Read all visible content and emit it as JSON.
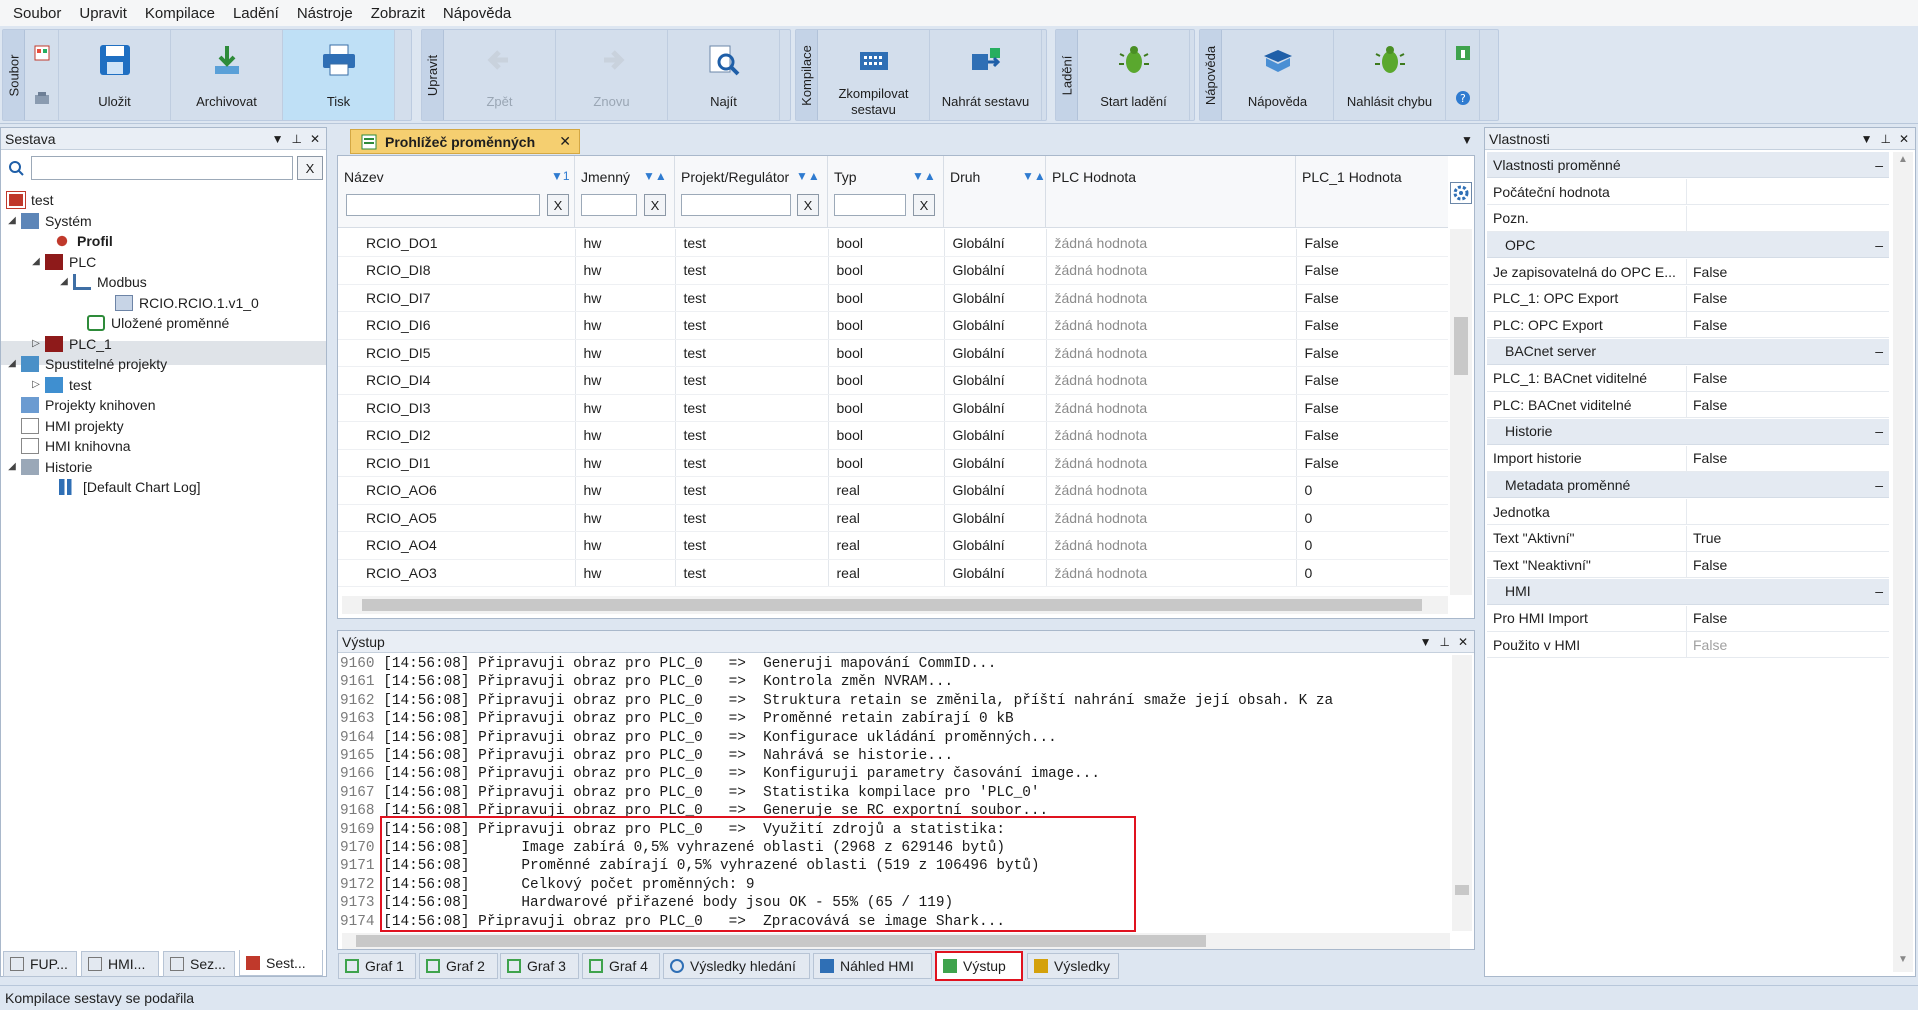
{
  "menu": [
    "Soubor",
    "Upravit",
    "Kompilace",
    "Ladění",
    "Nástroje",
    "Zobrazit",
    "Nápověda"
  ],
  "ribbon": {
    "groups": [
      "Soubor",
      "Upravit",
      "Kompilace",
      "Ladění",
      "Nápověda"
    ],
    "buttons": {
      "save": "Uložit",
      "archive": "Archivovat",
      "print": "Tisk",
      "undo": "Zpět",
      "redo": "Znovu",
      "find": "Najít",
      "compile": "Zkompilovat sestavu",
      "upload": "Nahrát sestavu",
      "debug": "Start ladění",
      "help": "Nápověda",
      "report": "Nahlásit chybu"
    }
  },
  "left_panel": {
    "title": "Sestava",
    "search_clear": "X",
    "tree": [
      "test",
      "Systém",
      "Profil",
      "PLC",
      "Modbus",
      "RCIO.RCIO.1.v1_0",
      "Uložené proměnné",
      "PLC_1",
      "Spustitelné projekty",
      "test",
      "Projekty knihoven",
      "HMI projekty",
      "HMI knihovna",
      "Historie",
      "[Default Chart Log]"
    ],
    "bottom_tabs": [
      "FUP...",
      "HMI...",
      "Sez...",
      "Sest..."
    ]
  },
  "doc_tab": {
    "title": "Prohlížeč proměnných",
    "close": "✕"
  },
  "grid": {
    "columns": [
      "Název",
      "Jmenný",
      "Projekt/Regulátor",
      "Typ",
      "Druh",
      "PLC Hodnota",
      "PLC_1 Hodnota"
    ],
    "sort_labels": [
      "▼1",
      "▼▲",
      "▼▲",
      "▼▲",
      "▼▲"
    ],
    "filter_clear": "X",
    "rows": [
      [
        "RCIO_DO1",
        "hw",
        "test",
        "bool",
        "Globální",
        "žádná hodnota",
        "False"
      ],
      [
        "RCIO_DI8",
        "hw",
        "test",
        "bool",
        "Globální",
        "žádná hodnota",
        "False"
      ],
      [
        "RCIO_DI7",
        "hw",
        "test",
        "bool",
        "Globální",
        "žádná hodnota",
        "False"
      ],
      [
        "RCIO_DI6",
        "hw",
        "test",
        "bool",
        "Globální",
        "žádná hodnota",
        "False"
      ],
      [
        "RCIO_DI5",
        "hw",
        "test",
        "bool",
        "Globální",
        "žádná hodnota",
        "False"
      ],
      [
        "RCIO_DI4",
        "hw",
        "test",
        "bool",
        "Globální",
        "žádná hodnota",
        "False"
      ],
      [
        "RCIO_DI3",
        "hw",
        "test",
        "bool",
        "Globální",
        "žádná hodnota",
        "False"
      ],
      [
        "RCIO_DI2",
        "hw",
        "test",
        "bool",
        "Globální",
        "žádná hodnota",
        "False"
      ],
      [
        "RCIO_DI1",
        "hw",
        "test",
        "bool",
        "Globální",
        "žádná hodnota",
        "False"
      ],
      [
        "RCIO_AO6",
        "hw",
        "test",
        "real",
        "Globální",
        "žádná hodnota",
        "0"
      ],
      [
        "RCIO_AO5",
        "hw",
        "test",
        "real",
        "Globální",
        "žádná hodnota",
        "0"
      ],
      [
        "RCIO_AO4",
        "hw",
        "test",
        "real",
        "Globální",
        "žádná hodnota",
        "0"
      ],
      [
        "RCIO_AO3",
        "hw",
        "test",
        "real",
        "Globální",
        "žádná hodnota",
        "0"
      ]
    ]
  },
  "output": {
    "title": "Výstup",
    "lines": [
      [
        "9160",
        "[14:56:08] Připravuji obraz pro PLC_0   =>  Generuji mapování CommID..."
      ],
      [
        "9161",
        "[14:56:08] Připravuji obraz pro PLC_0   =>  Kontrola změn NVRAM..."
      ],
      [
        "9162",
        "[14:56:08] Připravuji obraz pro PLC_0   =>  Struktura retain se změnila, příští nahrání smaže její obsah. K za"
      ],
      [
        "9163",
        "[14:56:08] Připravuji obraz pro PLC_0   =>  Proměnné retain zabírají 0 kB"
      ],
      [
        "9164",
        "[14:56:08] Připravuji obraz pro PLC_0   =>  Konfigurace ukládání proměnných..."
      ],
      [
        "9165",
        "[14:56:08] Připravuji obraz pro PLC_0   =>  Nahrává se historie..."
      ],
      [
        "9166",
        "[14:56:08] Připravuji obraz pro PLC_0   =>  Konfiguruji parametry časování image..."
      ],
      [
        "9167",
        "[14:56:08] Připravuji obraz pro PLC_0   =>  Statistika kompilace pro 'PLC_0'"
      ],
      [
        "9168",
        "[14:56:08] Připravuji obraz pro PLC_0   =>  Generuje se RC exportní soubor..."
      ],
      [
        "9169",
        "[14:56:08] Připravuji obraz pro PLC_0   =>  Využití zdrojů a statistika:"
      ],
      [
        "9170",
        "[14:56:08]      Image zabírá 0,5% vyhrazené oblasti (2968 z 629146 bytů)"
      ],
      [
        "9171",
        "[14:56:08]      Proměnné zabírají 0,5% vyhrazené oblasti (519 z 106496 bytů)"
      ],
      [
        "9172",
        "[14:56:08]      Celkový počet proměnných: 9"
      ],
      [
        "9173",
        "[14:56:08]      Hardwarové přiřazené body jsou OK - 55% (65 / 119)"
      ],
      [
        "9174",
        "[14:56:08] Připravuji obraz pro PLC_0   =>  Zpracovává se image Shark..."
      ]
    ]
  },
  "bottom_tabs": [
    "Graf 1",
    "Graf 2",
    "Graf 3",
    "Graf 4",
    "Výsledky hledání",
    "Náhled HMI",
    "Výstup",
    "Výsledky"
  ],
  "properties": {
    "title": "Vlastnosti",
    "sections": [
      {
        "name": "Vlastnosti proměnné",
        "rows": [
          [
            "Počáteční hodnota",
            ""
          ],
          [
            "Pozn.",
            ""
          ]
        ]
      },
      {
        "name": "OPC",
        "rows": [
          [
            "Je zapisovatelná do OPC E...",
            "False"
          ],
          [
            "PLC_1: OPC Export",
            "False"
          ],
          [
            "PLC: OPC Export",
            "False"
          ]
        ]
      },
      {
        "name": "BACnet server",
        "rows": [
          [
            "PLC_1: BACnet viditelné",
            "False"
          ],
          [
            "PLC: BACnet viditelné",
            "False"
          ]
        ]
      },
      {
        "name": "Historie",
        "rows": [
          [
            "Import historie",
            "False"
          ]
        ]
      },
      {
        "name": "Metadata proměnné",
        "rows": [
          [
            "Jednotka",
            ""
          ],
          [
            "Text \"Aktivní\"",
            "True"
          ],
          [
            "Text \"Neaktivní\"",
            "False"
          ]
        ]
      },
      {
        "name": "HMI",
        "rows": [
          [
            "Pro HMI Import",
            "False"
          ],
          [
            "Použito v HMI",
            "False"
          ]
        ]
      }
    ]
  },
  "status": "Kompilace sestavy se podařila",
  "highlight_color": "#e0121f"
}
